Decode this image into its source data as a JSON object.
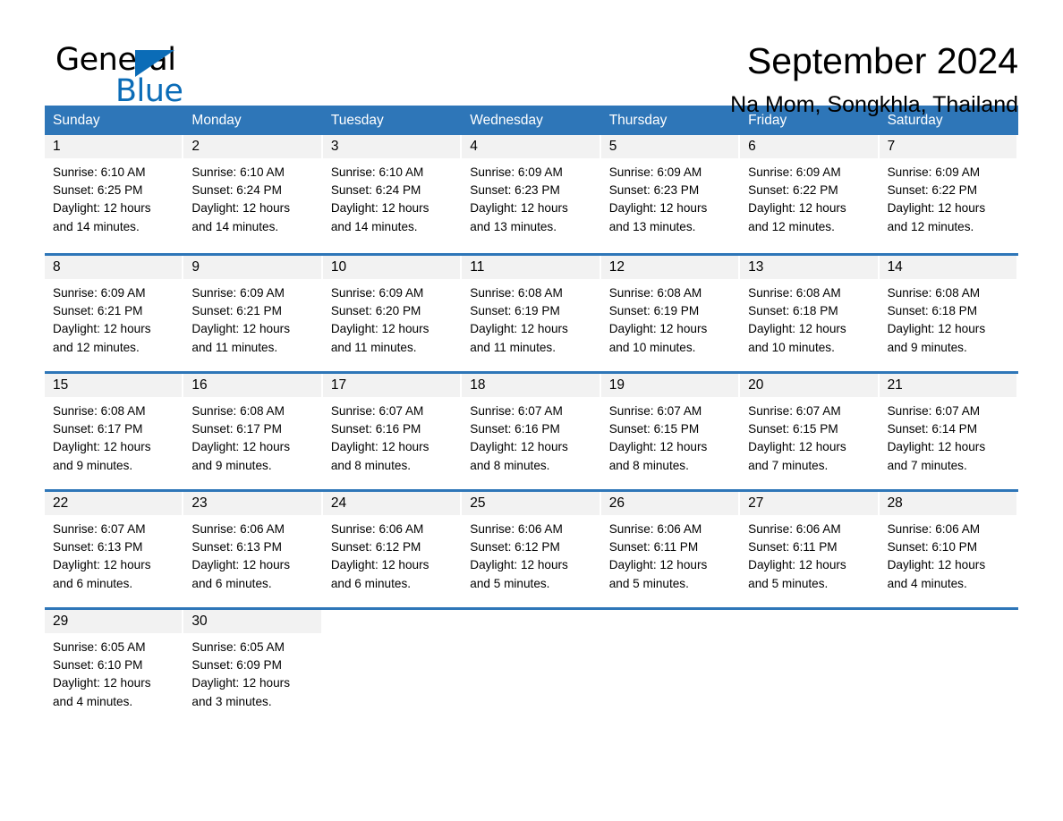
{
  "brand": {
    "name_part1": "General",
    "name_part2": "Blue",
    "accent_color": "#0b6cb7"
  },
  "header": {
    "title": "September 2024",
    "subtitle": "Na Mom, Songkhla, Thailand"
  },
  "calendar": {
    "header_bg": "#2e76b8",
    "daynum_bg": "#f2f2f2",
    "weekdays": [
      "Sunday",
      "Monday",
      "Tuesday",
      "Wednesday",
      "Thursday",
      "Friday",
      "Saturday"
    ],
    "weeks": [
      [
        {
          "day": "1",
          "sunrise": "Sunrise: 6:10 AM",
          "sunset": "Sunset: 6:25 PM",
          "daylight_1": "Daylight: 12 hours",
          "daylight_2": "and 14 minutes."
        },
        {
          "day": "2",
          "sunrise": "Sunrise: 6:10 AM",
          "sunset": "Sunset: 6:24 PM",
          "daylight_1": "Daylight: 12 hours",
          "daylight_2": "and 14 minutes."
        },
        {
          "day": "3",
          "sunrise": "Sunrise: 6:10 AM",
          "sunset": "Sunset: 6:24 PM",
          "daylight_1": "Daylight: 12 hours",
          "daylight_2": "and 14 minutes."
        },
        {
          "day": "4",
          "sunrise": "Sunrise: 6:09 AM",
          "sunset": "Sunset: 6:23 PM",
          "daylight_1": "Daylight: 12 hours",
          "daylight_2": "and 13 minutes."
        },
        {
          "day": "5",
          "sunrise": "Sunrise: 6:09 AM",
          "sunset": "Sunset: 6:23 PM",
          "daylight_1": "Daylight: 12 hours",
          "daylight_2": "and 13 minutes."
        },
        {
          "day": "6",
          "sunrise": "Sunrise: 6:09 AM",
          "sunset": "Sunset: 6:22 PM",
          "daylight_1": "Daylight: 12 hours",
          "daylight_2": "and 12 minutes."
        },
        {
          "day": "7",
          "sunrise": "Sunrise: 6:09 AM",
          "sunset": "Sunset: 6:22 PM",
          "daylight_1": "Daylight: 12 hours",
          "daylight_2": "and 12 minutes."
        }
      ],
      [
        {
          "day": "8",
          "sunrise": "Sunrise: 6:09 AM",
          "sunset": "Sunset: 6:21 PM",
          "daylight_1": "Daylight: 12 hours",
          "daylight_2": "and 12 minutes."
        },
        {
          "day": "9",
          "sunrise": "Sunrise: 6:09 AM",
          "sunset": "Sunset: 6:21 PM",
          "daylight_1": "Daylight: 12 hours",
          "daylight_2": "and 11 minutes."
        },
        {
          "day": "10",
          "sunrise": "Sunrise: 6:09 AM",
          "sunset": "Sunset: 6:20 PM",
          "daylight_1": "Daylight: 12 hours",
          "daylight_2": "and 11 minutes."
        },
        {
          "day": "11",
          "sunrise": "Sunrise: 6:08 AM",
          "sunset": "Sunset: 6:19 PM",
          "daylight_1": "Daylight: 12 hours",
          "daylight_2": "and 11 minutes."
        },
        {
          "day": "12",
          "sunrise": "Sunrise: 6:08 AM",
          "sunset": "Sunset: 6:19 PM",
          "daylight_1": "Daylight: 12 hours",
          "daylight_2": "and 10 minutes."
        },
        {
          "day": "13",
          "sunrise": "Sunrise: 6:08 AM",
          "sunset": "Sunset: 6:18 PM",
          "daylight_1": "Daylight: 12 hours",
          "daylight_2": "and 10 minutes."
        },
        {
          "day": "14",
          "sunrise": "Sunrise: 6:08 AM",
          "sunset": "Sunset: 6:18 PM",
          "daylight_1": "Daylight: 12 hours",
          "daylight_2": "and 9 minutes."
        }
      ],
      [
        {
          "day": "15",
          "sunrise": "Sunrise: 6:08 AM",
          "sunset": "Sunset: 6:17 PM",
          "daylight_1": "Daylight: 12 hours",
          "daylight_2": "and 9 minutes."
        },
        {
          "day": "16",
          "sunrise": "Sunrise: 6:08 AM",
          "sunset": "Sunset: 6:17 PM",
          "daylight_1": "Daylight: 12 hours",
          "daylight_2": "and 9 minutes."
        },
        {
          "day": "17",
          "sunrise": "Sunrise: 6:07 AM",
          "sunset": "Sunset: 6:16 PM",
          "daylight_1": "Daylight: 12 hours",
          "daylight_2": "and 8 minutes."
        },
        {
          "day": "18",
          "sunrise": "Sunrise: 6:07 AM",
          "sunset": "Sunset: 6:16 PM",
          "daylight_1": "Daylight: 12 hours",
          "daylight_2": "and 8 minutes."
        },
        {
          "day": "19",
          "sunrise": "Sunrise: 6:07 AM",
          "sunset": "Sunset: 6:15 PM",
          "daylight_1": "Daylight: 12 hours",
          "daylight_2": "and 8 minutes."
        },
        {
          "day": "20",
          "sunrise": "Sunrise: 6:07 AM",
          "sunset": "Sunset: 6:15 PM",
          "daylight_1": "Daylight: 12 hours",
          "daylight_2": "and 7 minutes."
        },
        {
          "day": "21",
          "sunrise": "Sunrise: 6:07 AM",
          "sunset": "Sunset: 6:14 PM",
          "daylight_1": "Daylight: 12 hours",
          "daylight_2": "and 7 minutes."
        }
      ],
      [
        {
          "day": "22",
          "sunrise": "Sunrise: 6:07 AM",
          "sunset": "Sunset: 6:13 PM",
          "daylight_1": "Daylight: 12 hours",
          "daylight_2": "and 6 minutes."
        },
        {
          "day": "23",
          "sunrise": "Sunrise: 6:06 AM",
          "sunset": "Sunset: 6:13 PM",
          "daylight_1": "Daylight: 12 hours",
          "daylight_2": "and 6 minutes."
        },
        {
          "day": "24",
          "sunrise": "Sunrise: 6:06 AM",
          "sunset": "Sunset: 6:12 PM",
          "daylight_1": "Daylight: 12 hours",
          "daylight_2": "and 6 minutes."
        },
        {
          "day": "25",
          "sunrise": "Sunrise: 6:06 AM",
          "sunset": "Sunset: 6:12 PM",
          "daylight_1": "Daylight: 12 hours",
          "daylight_2": "and 5 minutes."
        },
        {
          "day": "26",
          "sunrise": "Sunrise: 6:06 AM",
          "sunset": "Sunset: 6:11 PM",
          "daylight_1": "Daylight: 12 hours",
          "daylight_2": "and 5 minutes."
        },
        {
          "day": "27",
          "sunrise": "Sunrise: 6:06 AM",
          "sunset": "Sunset: 6:11 PM",
          "daylight_1": "Daylight: 12 hours",
          "daylight_2": "and 5 minutes."
        },
        {
          "day": "28",
          "sunrise": "Sunrise: 6:06 AM",
          "sunset": "Sunset: 6:10 PM",
          "daylight_1": "Daylight: 12 hours",
          "daylight_2": "and 4 minutes."
        }
      ],
      [
        {
          "day": "29",
          "sunrise": "Sunrise: 6:05 AM",
          "sunset": "Sunset: 6:10 PM",
          "daylight_1": "Daylight: 12 hours",
          "daylight_2": "and 4 minutes."
        },
        {
          "day": "30",
          "sunrise": "Sunrise: 6:05 AM",
          "sunset": "Sunset: 6:09 PM",
          "daylight_1": "Daylight: 12 hours",
          "daylight_2": "and 3 minutes."
        },
        {
          "day": "",
          "sunrise": "",
          "sunset": "",
          "daylight_1": "",
          "daylight_2": ""
        },
        {
          "day": "",
          "sunrise": "",
          "sunset": "",
          "daylight_1": "",
          "daylight_2": ""
        },
        {
          "day": "",
          "sunrise": "",
          "sunset": "",
          "daylight_1": "",
          "daylight_2": ""
        },
        {
          "day": "",
          "sunrise": "",
          "sunset": "",
          "daylight_1": "",
          "daylight_2": ""
        },
        {
          "day": "",
          "sunrise": "",
          "sunset": "",
          "daylight_1": "",
          "daylight_2": ""
        }
      ]
    ]
  }
}
